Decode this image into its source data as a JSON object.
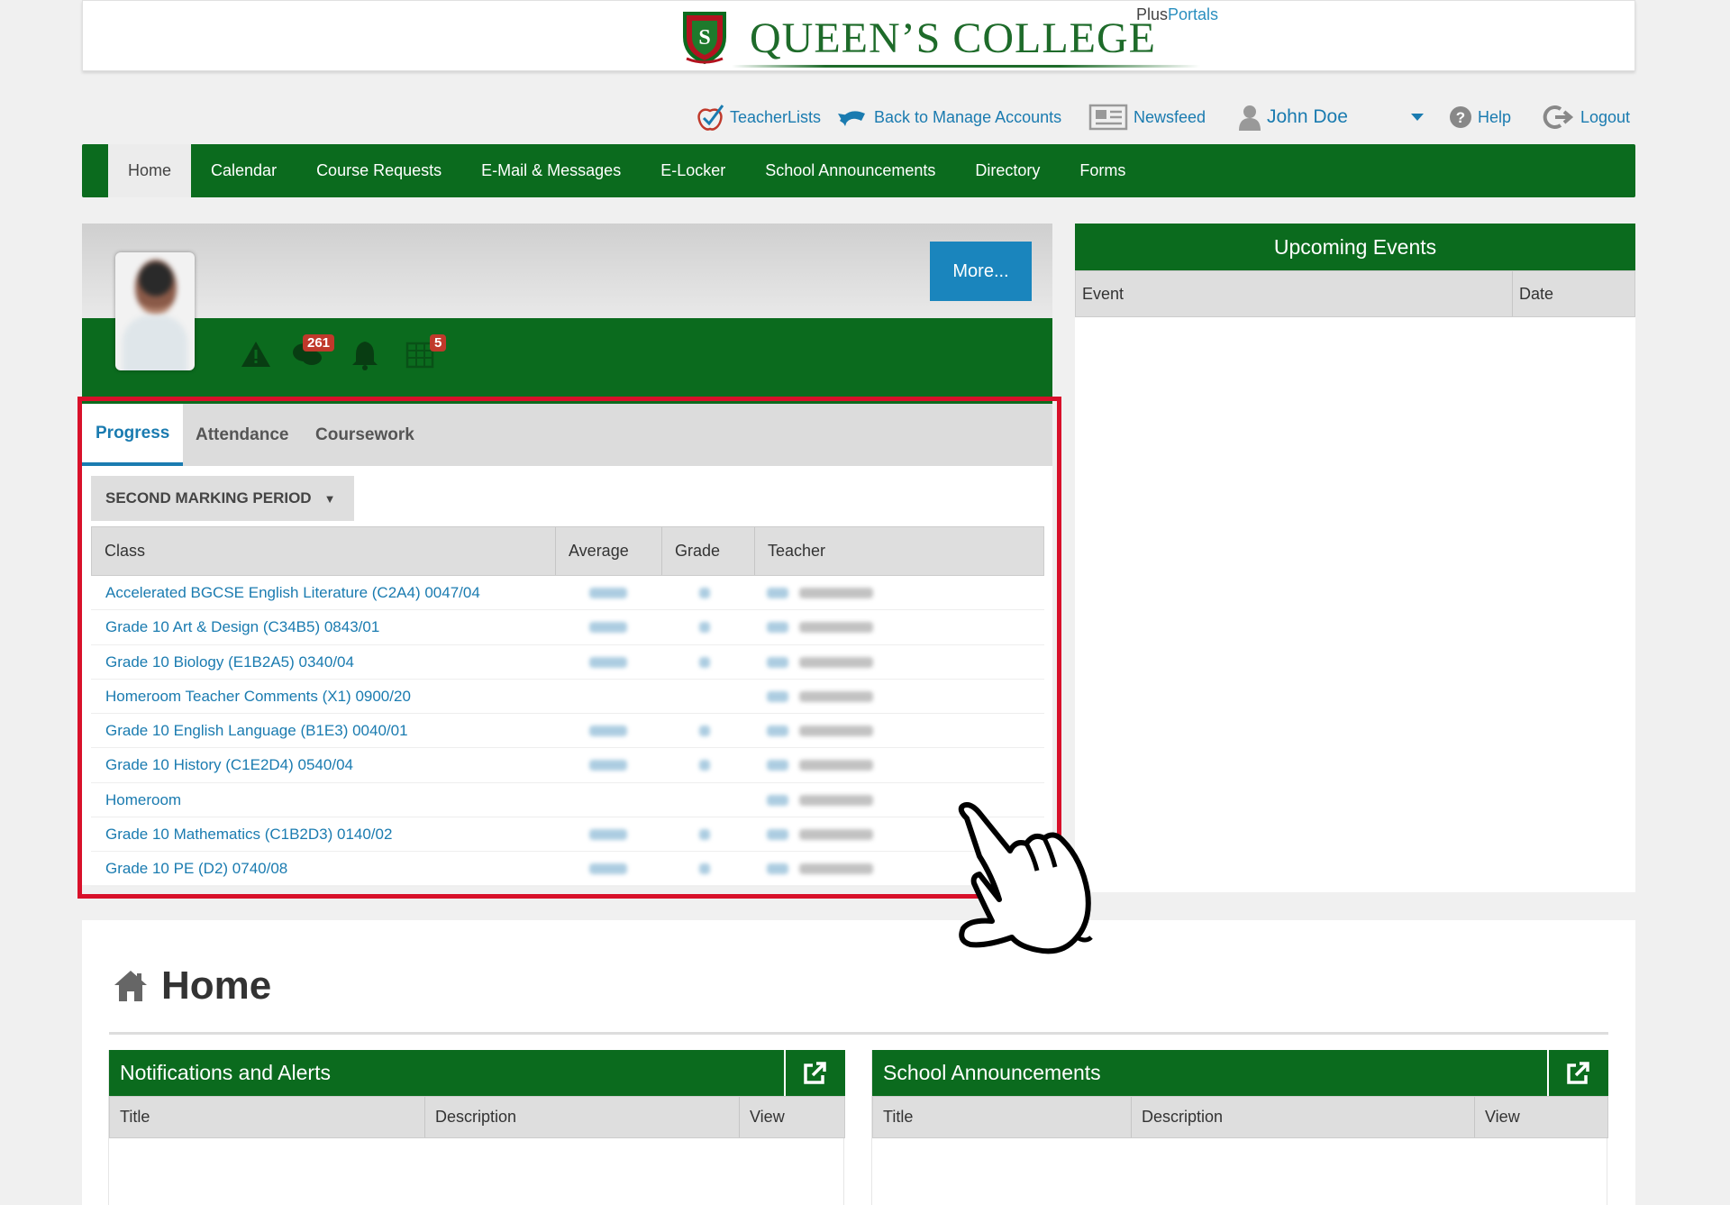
{
  "header": {
    "school_name": "QUEEN’S COLLEGE",
    "brand_plus": "Plus",
    "brand_portals": "Portals"
  },
  "toplinks": {
    "teacher_lists": "TeacherLists",
    "back_manage": "Back to Manage Accounts",
    "newsfeed": "Newsfeed",
    "user_name": "John Doe",
    "help": "Help",
    "logout": "Logout"
  },
  "nav": {
    "items": [
      "Home",
      "Calendar",
      "Course Requests",
      "E-Mail & Messages",
      "E-Locker",
      "School Announcements",
      "Directory",
      "Forms"
    ],
    "active": "Home"
  },
  "profile": {
    "more_label": "More...",
    "messages_count": "261",
    "grid_count": "5"
  },
  "progress": {
    "tabs": [
      "Progress",
      "Attendance",
      "Coursework"
    ],
    "active_tab": "Progress",
    "period": "SECOND MARKING PERIOD",
    "columns": [
      "Class",
      "Average",
      "Grade",
      "Teacher"
    ],
    "rows": [
      {
        "class": "Accelerated BGCSE English Literature (C2A4) 0047/04"
      },
      {
        "class": "Grade 10 Art & Design (C34B5) 0843/01"
      },
      {
        "class": "Grade 10 Biology (E1B2A5) 0340/04"
      },
      {
        "class": "Homeroom Teacher Comments (X1) 0900/20"
      },
      {
        "class": "Grade 10 English Language (B1E3) 0040/01"
      },
      {
        "class": "Grade 10 History (C1E2D4) 0540/04"
      },
      {
        "class": "Homeroom"
      },
      {
        "class": "Grade 10 Mathematics (C1B2D3) 0140/02"
      },
      {
        "class": "Grade 10 PE (D2) 0740/08"
      }
    ]
  },
  "events": {
    "title": "Upcoming Events",
    "columns": [
      "Event",
      "Date"
    ]
  },
  "home": {
    "title": "Home",
    "widgets": [
      {
        "title": "Notifications and Alerts",
        "columns": [
          "Title",
          "Description",
          "View"
        ]
      },
      {
        "title": "School Announcements",
        "columns": [
          "Title",
          "Description",
          "View"
        ]
      }
    ]
  },
  "colors": {
    "brand_green": "#0b6b1e",
    "link_blue": "#1a7bb0",
    "highlight_red": "#d8102a"
  }
}
